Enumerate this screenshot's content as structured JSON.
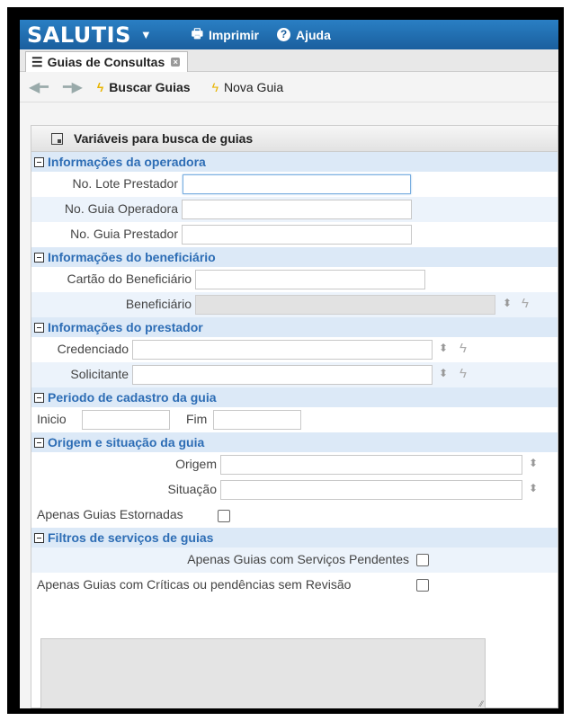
{
  "app": {
    "brand": "SALUTIS",
    "print_label": "Imprimir",
    "help_label": "Ajuda"
  },
  "tab": {
    "label": "Guias de Consultas"
  },
  "toolbar": {
    "search_label": "Buscar Guias",
    "new_label": "Nova Guia"
  },
  "panel": {
    "title": "Variáveis para busca de guias"
  },
  "sections": {
    "operadora": "Informações da operadora",
    "beneficiario": "Informações do beneficiário",
    "prestador": "Informações do prestador",
    "periodo": "Periodo de cadastro da guia",
    "origem": "Origem e situação da guia",
    "filtros": "Filtros de serviços de guias"
  },
  "fields": {
    "lote_prestador": {
      "label": "No. Lote Prestador",
      "value": ""
    },
    "guia_operadora": {
      "label": "No. Guia Operadora",
      "value": ""
    },
    "guia_prestador": {
      "label": "No. Guia Prestador",
      "value": ""
    },
    "cartao": {
      "label": "Cartão do Beneficiário",
      "value": ""
    },
    "beneficiario": {
      "label": "Beneficiário",
      "value": ""
    },
    "credenciado": {
      "label": "Credenciado",
      "value": ""
    },
    "solicitante": {
      "label": "Solicitante",
      "value": ""
    },
    "inicio": {
      "label": "Inicio",
      "value": ""
    },
    "fim": {
      "label": "Fim",
      "value": ""
    },
    "origem": {
      "label": "Origem",
      "value": ""
    },
    "situacao": {
      "label": "Situação",
      "value": ""
    },
    "estornadas": {
      "label": "Apenas Guias Estornadas",
      "checked": false
    },
    "servicos_pendentes": {
      "label": "Apenas Guias com Serviços Pendentes",
      "checked": false
    },
    "criticas": {
      "label": "Apenas Guias com Críticas ou pendências sem Revisão",
      "checked": false
    }
  },
  "colors": {
    "header_blue": "#1a5f9e",
    "section_bg": "#dce9f7",
    "section_text": "#2d6db5",
    "bolt": "#e8b400"
  },
  "icons": [
    "caret-down-icon",
    "printer-icon",
    "help-icon",
    "list-icon",
    "close-icon",
    "back-arrow-icon",
    "forward-arrow-icon",
    "bolt-icon",
    "collapse-icon",
    "spinner-icon",
    "lookup-bolt-icon"
  ]
}
